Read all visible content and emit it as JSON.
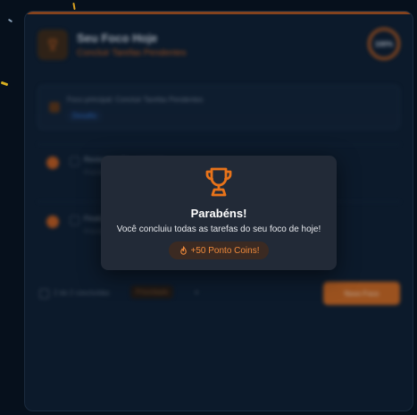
{
  "background": {
    "header": {
      "title": "Seu Foco Hoje",
      "subtitle": "Concluir Tarefas Pendentes",
      "progress_text": "100%"
    },
    "focus": {
      "label": "Foco principal: Concluir Tarefas Pendentes",
      "tag": "Desafio"
    },
    "tasks": [
      {
        "title": "Revisar tarefas pendentes",
        "meta": "Prioridade alta"
      },
      {
        "title": "Finalizar entregas do dia",
        "meta": "Prioridade média"
      }
    ],
    "footer": {
      "count_text": "2 de 2 concluídas",
      "chip_label": "Prioridade",
      "cta_label": "Novo Foco"
    }
  },
  "modal": {
    "icon": "trophy-icon",
    "title": "Parabéns!",
    "message": "Você concluiu todas as tarefas do seu foco de hoje!",
    "reward_icon": "fire-icon",
    "reward": "+50 Ponto Coins!"
  },
  "colors": {
    "accent": "#e8731a",
    "modal_bg": "#222a37",
    "page_bg": "#06101c",
    "reward_text": "#ef8a3c",
    "reward_bg": "#3b2a22"
  }
}
